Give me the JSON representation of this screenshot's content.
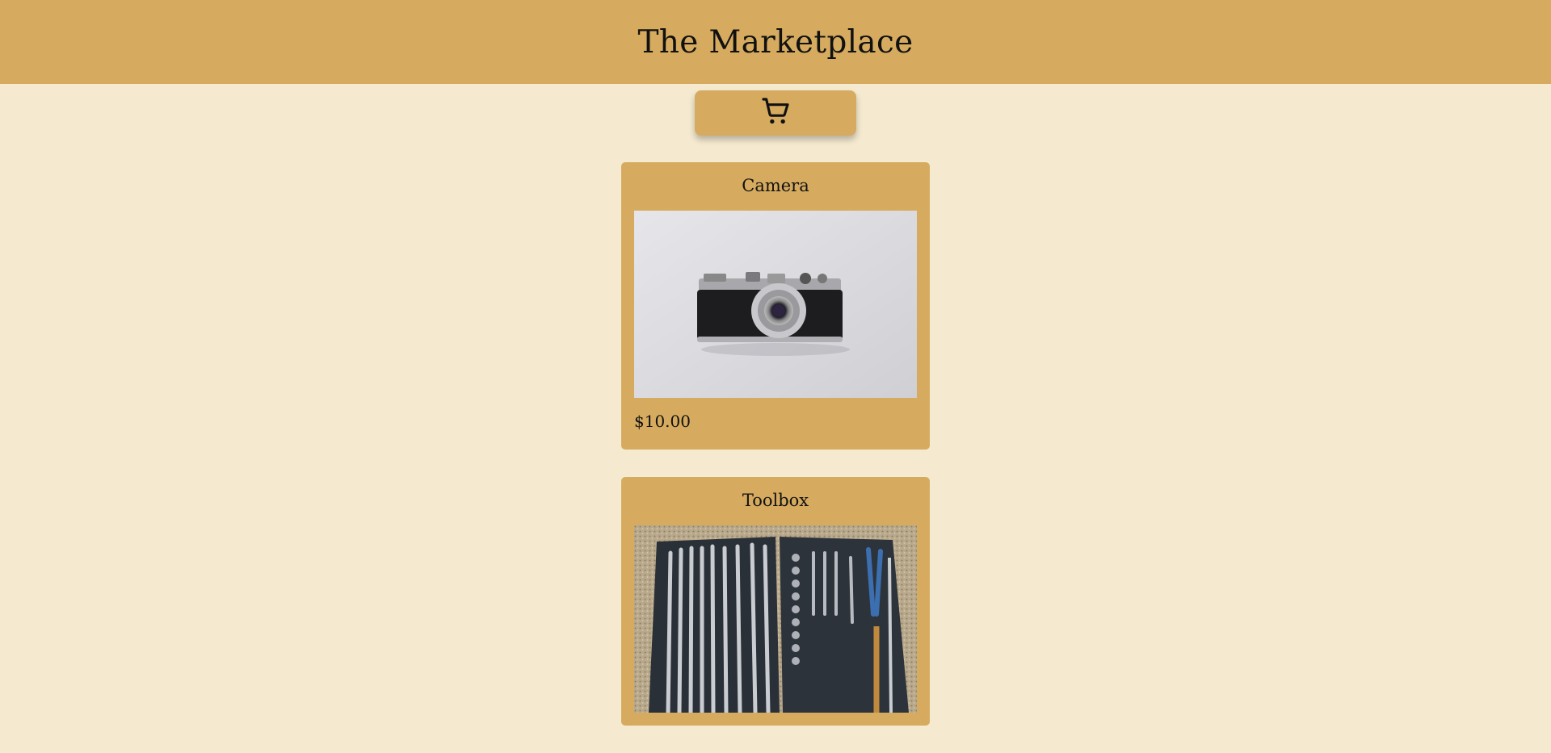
{
  "header": {
    "title": "The Marketplace"
  },
  "cart": {
    "icon": "shopping-cart-icon"
  },
  "products": [
    {
      "name": "Camera",
      "price": "$10.00",
      "image_icon": "camera-photo"
    },
    {
      "name": "Toolbox",
      "price": "",
      "image_icon": "toolbox-photo"
    }
  ],
  "colors": {
    "accent": "#d6ab5f",
    "background": "#f5ead0"
  }
}
